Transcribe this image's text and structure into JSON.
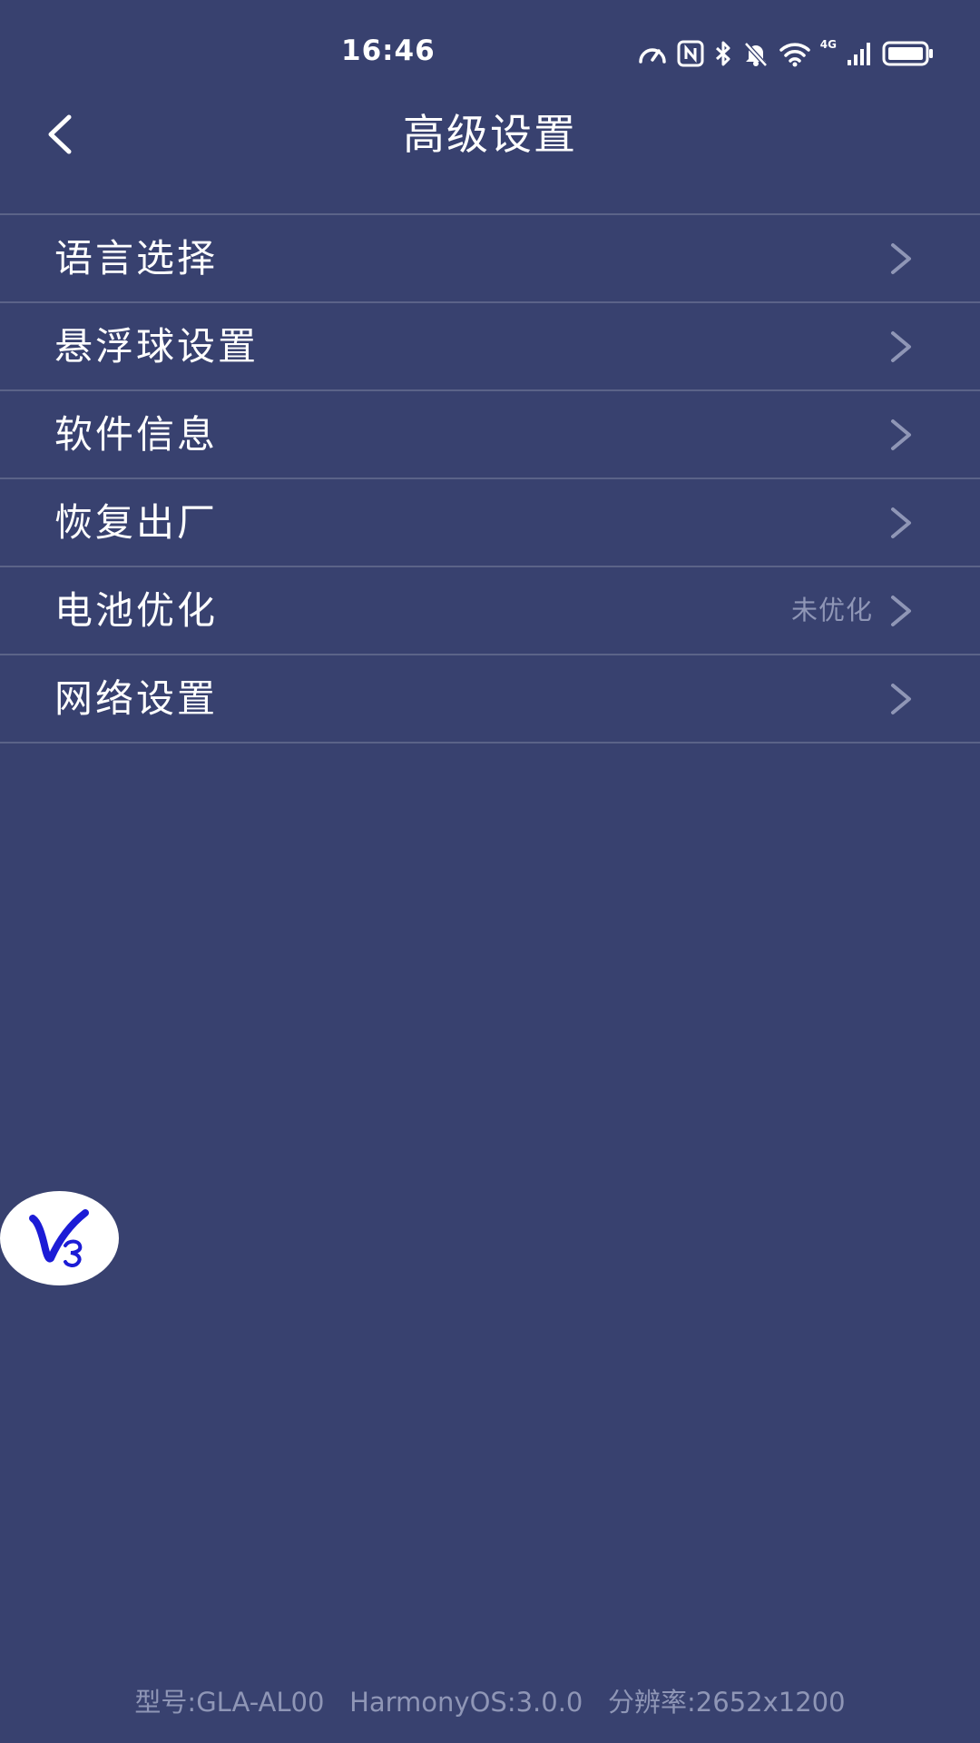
{
  "status_bar": {
    "time": "16:46",
    "network_label": "4G",
    "icons": [
      "speedometer-icon",
      "nfc-icon",
      "bluetooth-icon",
      "bell-off-icon",
      "wifi-icon",
      "signal-icon",
      "battery-icon"
    ]
  },
  "header": {
    "back_icon": "chevron-left-icon",
    "title": "高级设置"
  },
  "settings": {
    "items": [
      {
        "label": "语言选择",
        "value": ""
      },
      {
        "label": "悬浮球设置",
        "value": ""
      },
      {
        "label": "软件信息",
        "value": ""
      },
      {
        "label": "恢复出厂",
        "value": ""
      },
      {
        "label": "电池优化",
        "value": "未优化"
      },
      {
        "label": "网络设置",
        "value": ""
      }
    ]
  },
  "footer": {
    "info": "型号:GLA-AL00   HarmonyOS:3.0.0   分辨率:2652x1200"
  },
  "colors": {
    "background": "#38416f",
    "divider": "#5b6388",
    "secondary_text": "#8f96b6",
    "chevron": "#8f96b6",
    "logo_blue": "#1c1cd6"
  }
}
